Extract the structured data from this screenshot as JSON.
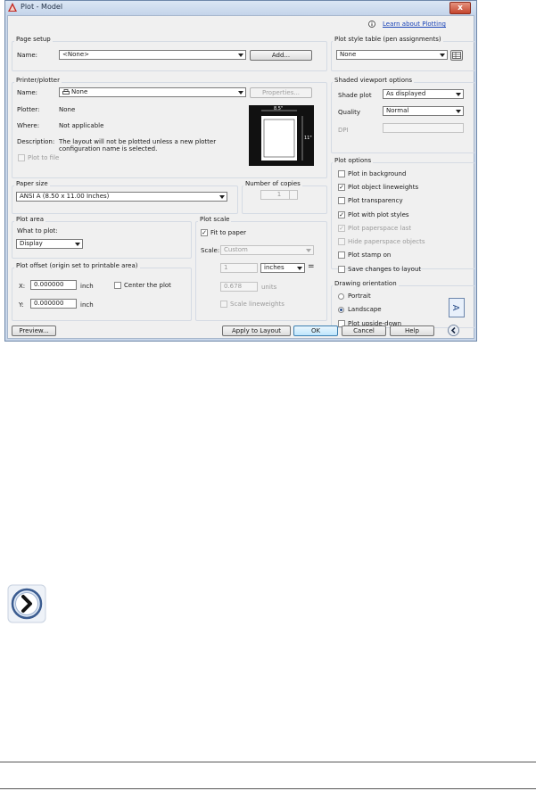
{
  "window": {
    "title": "Plot - Model",
    "close_label": "x"
  },
  "help_link": "Learn about Plotting",
  "page_setup": {
    "group": "Page setup",
    "name_label": "Name:",
    "name_value": "<None>",
    "add_label": "Add..."
  },
  "printer": {
    "group": "Printer/plotter",
    "name_label": "Name:",
    "name_value": "None",
    "properties_label": "Properties...",
    "plotter_label": "Plotter:",
    "plotter_value": "None",
    "where_label": "Where:",
    "where_value": "Not applicable",
    "description_label": "Description:",
    "description_line1": "The layout will not be plotted unless a new plotter",
    "description_line2": "configuration name is selected.",
    "plot_to_file": "Plot to file",
    "preview_width": "8.5\"",
    "preview_height": "11\""
  },
  "paper_size": {
    "group": "Paper size",
    "value": "ANSI A (8.50 x 11.00 Inches)"
  },
  "copies": {
    "group": "Number of copies",
    "value": "1"
  },
  "plot_area": {
    "group": "Plot area",
    "what_label": "What to plot:",
    "what_value": "Display"
  },
  "plot_offset": {
    "group": "Plot offset (origin set to printable area)",
    "x_label": "X:",
    "x_value": "0.000000",
    "x_unit": "inch",
    "y_label": "Y:",
    "y_value": "0.000000",
    "y_unit": "inch",
    "center_label": "Center the plot"
  },
  "plot_scale": {
    "group": "Plot scale",
    "fit_label": "Fit to paper",
    "scale_label": "Scale:",
    "scale_value": "Custom",
    "value1": "1",
    "unit_value": "inches",
    "equals": "=",
    "value2": "0.678",
    "units_label": "units",
    "lineweights_label": "Scale lineweights"
  },
  "plot_style": {
    "group": "Plot style table (pen assignments)",
    "value": "None"
  },
  "shaded": {
    "group": "Shaded viewport options",
    "shade_label": "Shade plot",
    "shade_value": "As displayed",
    "quality_label": "Quality",
    "quality_value": "Normal",
    "dpi_label": "DPI"
  },
  "plot_options": {
    "group": "Plot options",
    "items": [
      {
        "label": "Plot in background",
        "checked": ""
      },
      {
        "label": "Plot object lineweights",
        "checked": "✓"
      },
      {
        "label": "Plot transparency",
        "checked": ""
      },
      {
        "label": "Plot with plot styles",
        "checked": "✓"
      },
      {
        "label": "Plot paperspace last",
        "checked": "✓"
      },
      {
        "label": "Hide paperspace objects",
        "checked": ""
      },
      {
        "label": "Plot stamp on",
        "checked": ""
      },
      {
        "label": "Save changes to layout",
        "checked": ""
      }
    ]
  },
  "orientation": {
    "group": "Drawing orientation",
    "portrait": "Portrait",
    "landscape": "Landscape",
    "upside_down": "Plot upside-down"
  },
  "footer": {
    "preview": "Preview...",
    "apply": "Apply to Layout",
    "ok": "OK",
    "cancel": "Cancel",
    "help": "Help"
  },
  "check_mark": "✓",
  "colors": {
    "title_bar": "#c4d4ea",
    "client": "#f0f0f0",
    "accent": "#2b4f8c"
  }
}
